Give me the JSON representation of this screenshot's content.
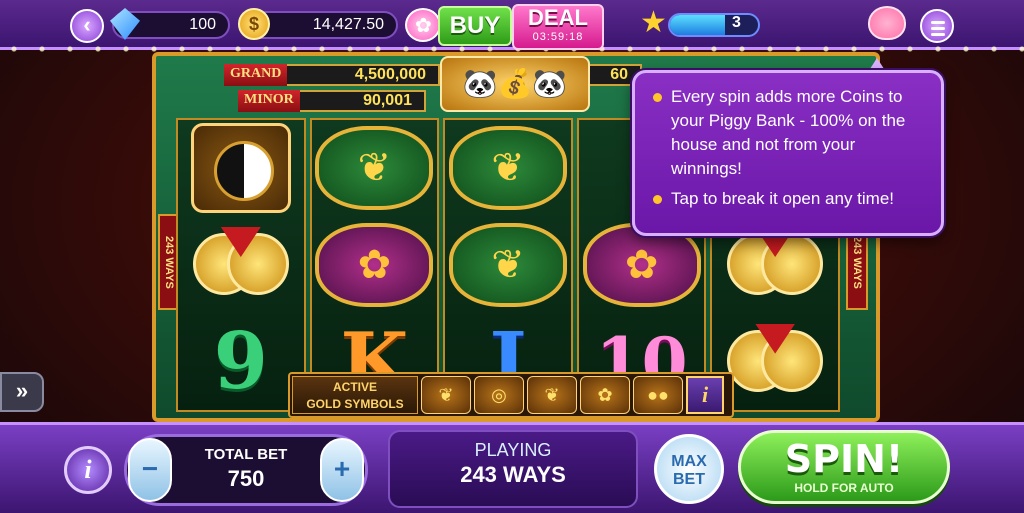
{
  "topbar": {
    "gems": "100",
    "coins": "14,427.50",
    "coin_symbol": "$",
    "buy_label": "BUY",
    "deal_label": "DEAL",
    "deal_timer": "03:59:18",
    "level": "3",
    "xp_fraction": 0.62,
    "icons": [
      "back-arrow-icon",
      "gem-icon",
      "coin-icon",
      "gift-icon",
      "star-icon",
      "piggy-bank-icon",
      "menu-icon"
    ]
  },
  "jackpots": {
    "grand_label": "GRAND",
    "grand_value": "4,500,000",
    "minor_label": "MINOR",
    "minor_value": "90,001",
    "right_partial": "60"
  },
  "ways_side_label": "243 WAYS",
  "reels": [
    [
      "yin-yang",
      "coins",
      "9"
    ],
    [
      "crane",
      "lotus",
      "K"
    ],
    [
      "crane",
      "crane",
      "J"
    ],
    [
      "",
      "lotus",
      "10"
    ],
    [
      "",
      "coins",
      "coins"
    ]
  ],
  "gold_strip": {
    "label_line1": "ACTIVE",
    "label_line2": "GOLD SYMBOLS",
    "info_label": "i"
  },
  "tooltip": {
    "lines": [
      "Every spin adds more Coins to your Piggy Bank - 100% on the house and not from your winnings!",
      "Tap to break it open any time!"
    ]
  },
  "bottombar": {
    "info_label": "i",
    "total_bet_label": "TOTAL BET",
    "total_bet_value": "750",
    "minus_label": "−",
    "plus_label": "+",
    "playing_label": "PLAYING",
    "playing_value": "243 WAYS",
    "maxbet_line1": "MAX",
    "maxbet_line2": "BET",
    "spin_label": "SPIN!",
    "spin_sub": "HOLD FOR AUTO"
  },
  "colors": {
    "accent_purple": "#5b2a8e",
    "spin_green": "#2c9a1a",
    "deal_pink": "#d61a8e",
    "gold": "#d99a2a"
  }
}
